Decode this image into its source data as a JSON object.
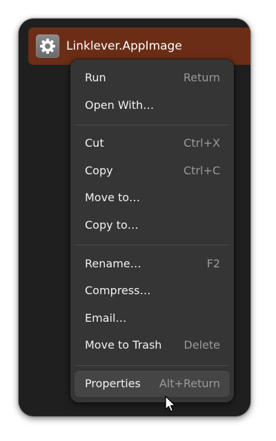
{
  "file": {
    "name": "Linklever.AppImage",
    "icon": "gear-icon",
    "selection_color": "#6b2d16"
  },
  "menu": {
    "items": [
      {
        "label": "Run",
        "shortcut": "Return"
      },
      {
        "label": "Open With…",
        "shortcut": ""
      },
      {
        "label": "Cut",
        "shortcut": "Ctrl+X"
      },
      {
        "label": "Copy",
        "shortcut": "Ctrl+C"
      },
      {
        "label": "Move to…",
        "shortcut": ""
      },
      {
        "label": "Copy to…",
        "shortcut": ""
      },
      {
        "label": "Rename…",
        "shortcut": "F2"
      },
      {
        "label": "Compress…",
        "shortcut": ""
      },
      {
        "label": "Email…",
        "shortcut": ""
      },
      {
        "label": "Move to Trash",
        "shortcut": "Delete"
      },
      {
        "label": "Properties",
        "shortcut": "Alt+Return"
      }
    ],
    "highlighted_index": 10
  }
}
